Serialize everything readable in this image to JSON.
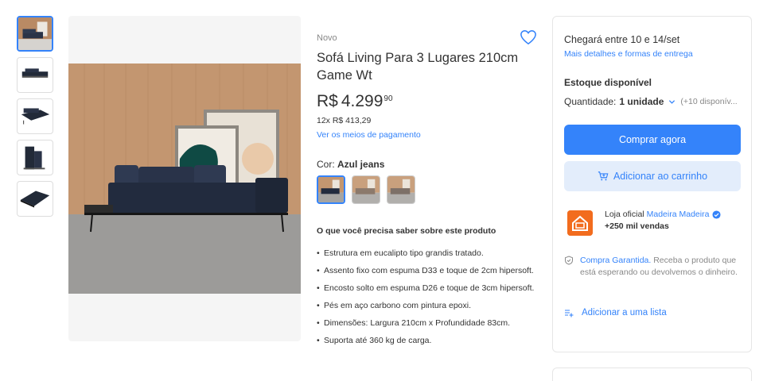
{
  "product": {
    "condition": "Novo",
    "title": "Sofá Living Para 3 Lugares 210cm Game Wt",
    "price": {
      "currency": "R$",
      "integer": "4.299",
      "cents": "90"
    },
    "installments": "12x R$ 413,29",
    "payment_link": "Ver os meios de pagamento",
    "color_prefix": "Cor:",
    "color_value": "Azul jeans",
    "features_title": "O que você precisa saber sobre este produto",
    "features": [
      "Estrutura em eucalipto tipo grandis tratado.",
      "Assento fixo com espuma D33 e toque de 2cm hipersoft.",
      "Encosto solto em espuma D26 e toque de 3cm hipersoft.",
      "Pés em aço carbono com pintura epoxi.",
      "Dimensões: Largura 210cm x Profundidade 83cm.",
      "Suporta até 360 kg de carga."
    ]
  },
  "buybox": {
    "shipping_title": "Chegará entre 10 e 14/set",
    "shipping_link": "Mais detalhes e formas de entrega",
    "stock_title": "Estoque disponível",
    "quantity_label": "Quantidade:",
    "quantity_value": "1 unidade",
    "quantity_available": "(+10 disponív...",
    "buy_now": "Comprar agora",
    "add_to_cart": "Adicionar ao carrinho",
    "seller_prefix": "Loja oficial",
    "seller_name": "Madeira Madeira",
    "seller_sales": "+250 mil vendas",
    "guarantee_link": "Compra Garantida.",
    "guarantee_text": "Receba o produto que está esperando ou devolvemos o dinheiro.",
    "add_to_list": "Adicionar a uma lista"
  },
  "icons": {
    "favorite": "heart-icon",
    "quantity_toggle": "chevron-down-icon",
    "cart": "cart-add-icon",
    "verified": "verified-badge-icon",
    "guarantee": "shield-check-icon",
    "list": "list-add-icon"
  },
  "colors": {
    "accent": "#3483fa",
    "accent_light": "#e3edfb",
    "text": "#333333",
    "muted": "#888888",
    "seller_brand": "#f26c1e",
    "sofa": "#2a3347"
  }
}
